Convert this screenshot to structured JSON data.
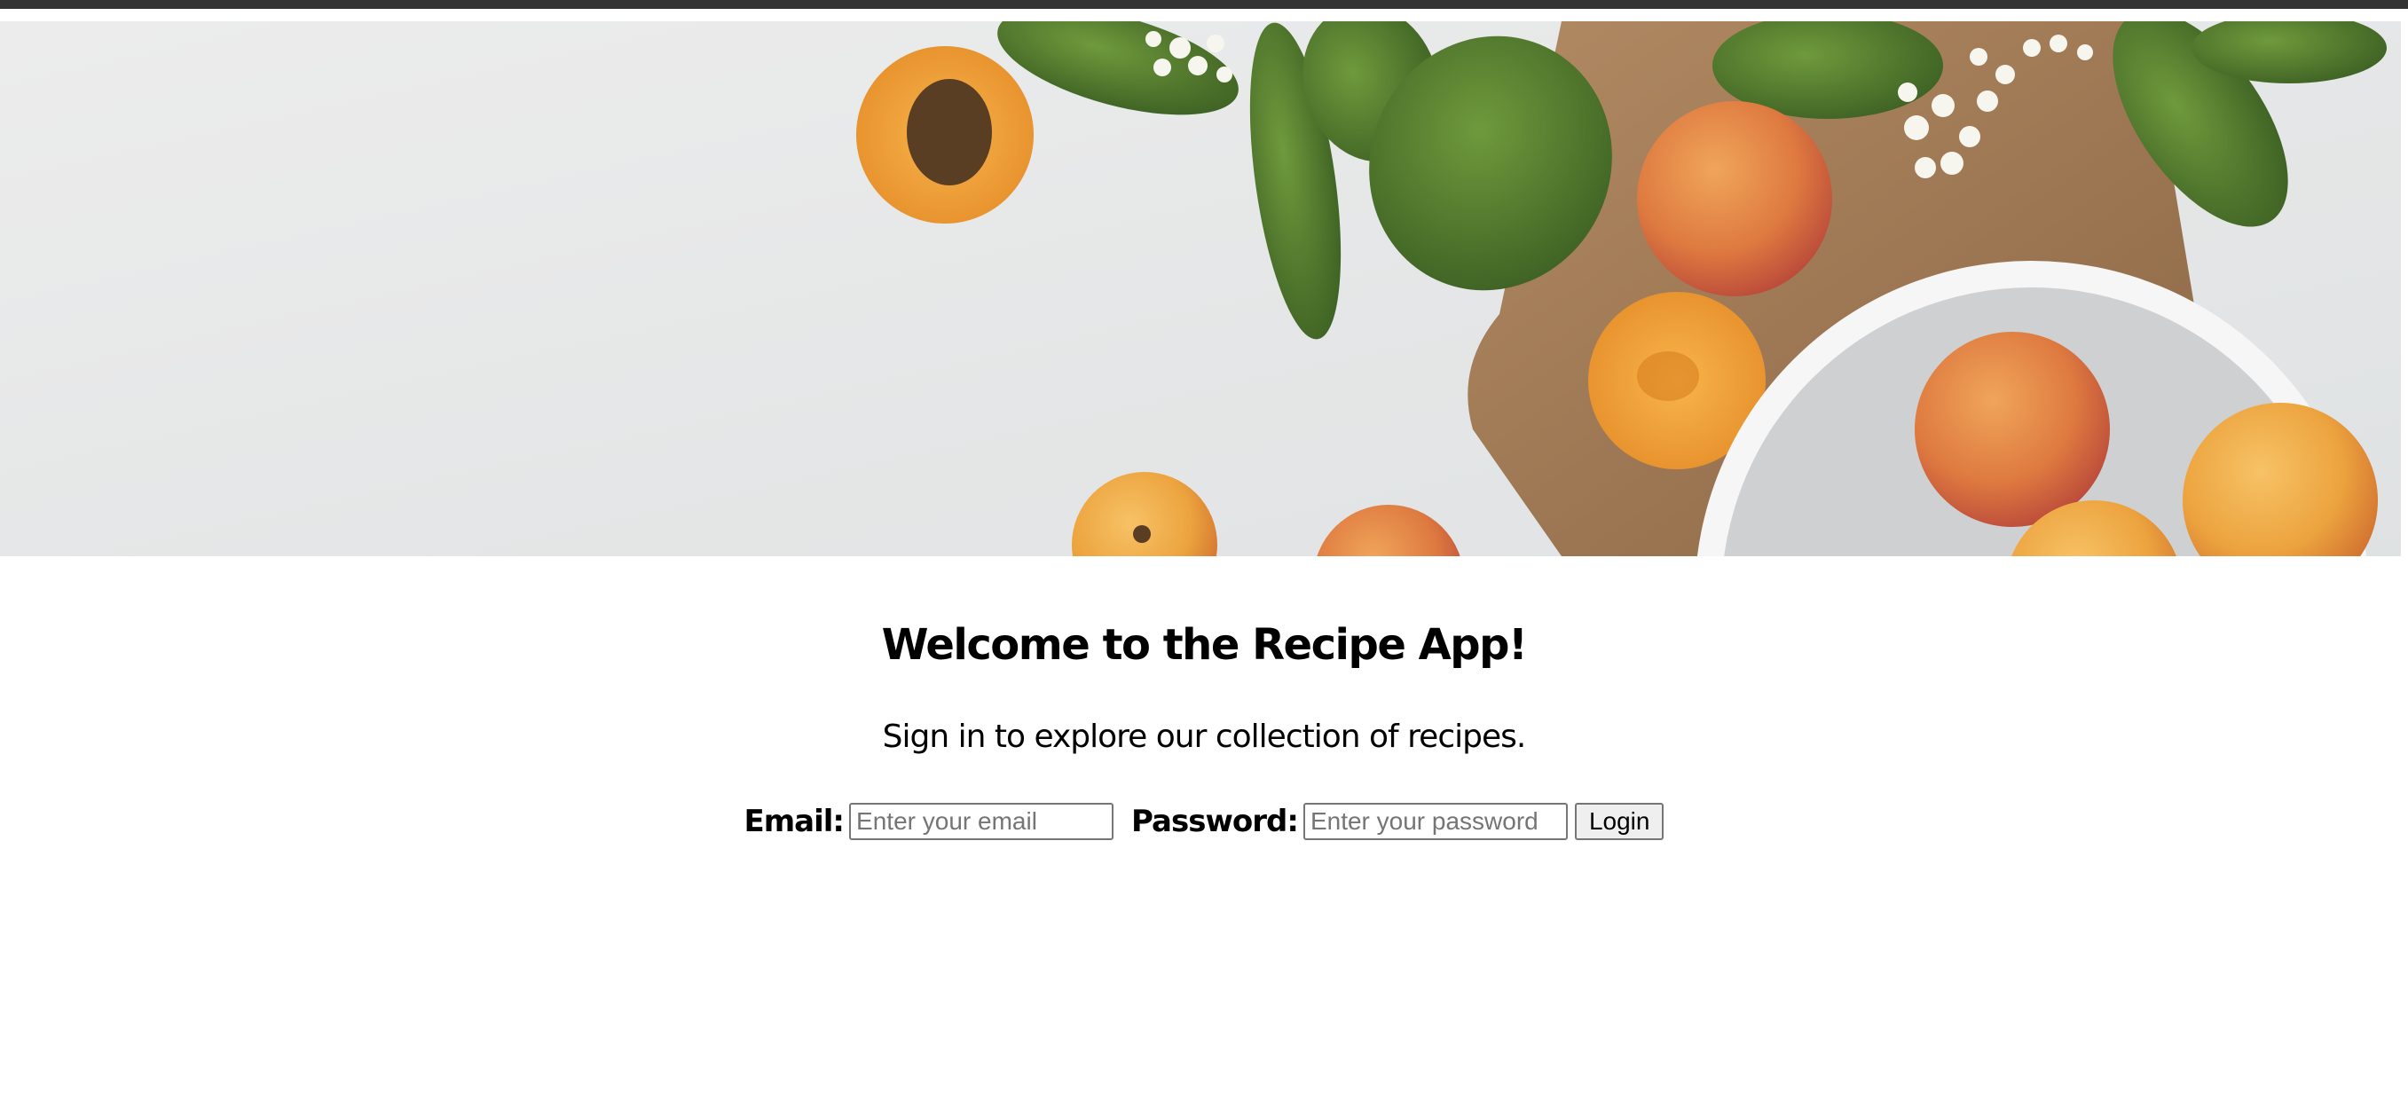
{
  "hero": {
    "image_name": "apricots-banner-image"
  },
  "main": {
    "title": "Welcome to the Recipe App!",
    "subtitle": "Sign in to explore our collection of recipes."
  },
  "login": {
    "email_label": "Email:",
    "email_placeholder": "Enter your email",
    "email_value": "",
    "password_label": "Password:",
    "password_placeholder": "Enter your password",
    "password_value": "",
    "login_button_label": "Login"
  },
  "colors": {
    "topbar": "#333333",
    "page_background": "#ffffff",
    "text": "#000000"
  }
}
